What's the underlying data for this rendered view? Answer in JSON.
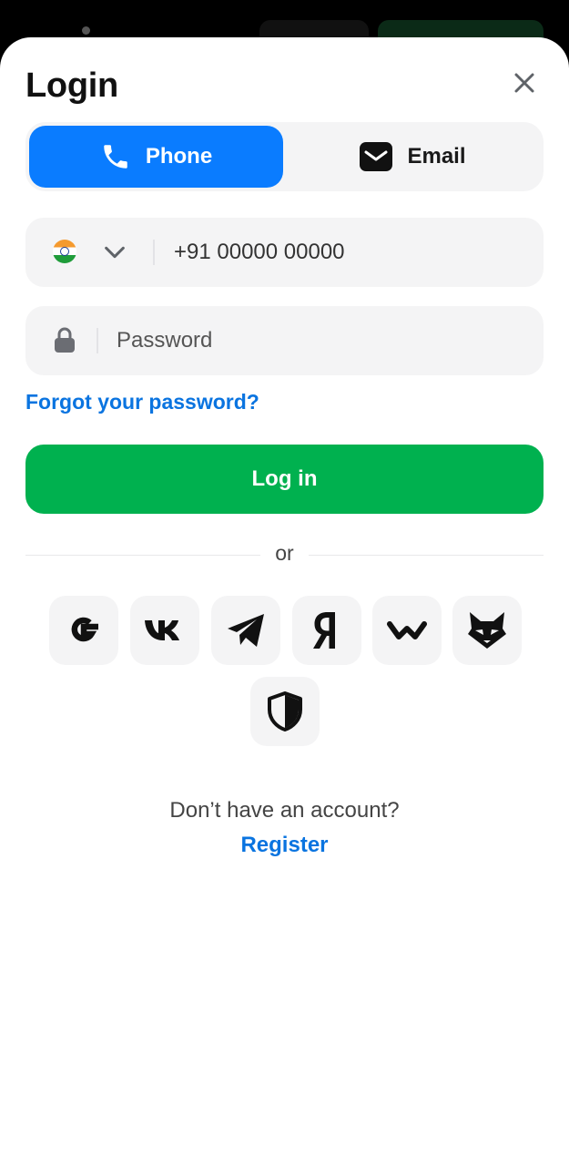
{
  "title": "Login",
  "tabs": {
    "phone_label": "Phone",
    "email_label": "Email",
    "active": "phone"
  },
  "phone": {
    "country_flag": "india-flag",
    "placeholder": "+91 00000 00000"
  },
  "password": {
    "placeholder": "Password"
  },
  "forgot_label": "Forgot your password?",
  "login_label": "Log in",
  "or_label": "or",
  "social": [
    "google-icon",
    "vk-icon",
    "telegram-icon",
    "yandex-icon",
    "walletconnect-icon",
    "metamask-fox-icon",
    "shield-icon"
  ],
  "footer": {
    "question": "Don’t have an account?",
    "register_label": "Register"
  },
  "colors": {
    "accent_blue": "#0a7cff",
    "link_blue": "#0a74e0",
    "primary_green": "#00b14f"
  }
}
